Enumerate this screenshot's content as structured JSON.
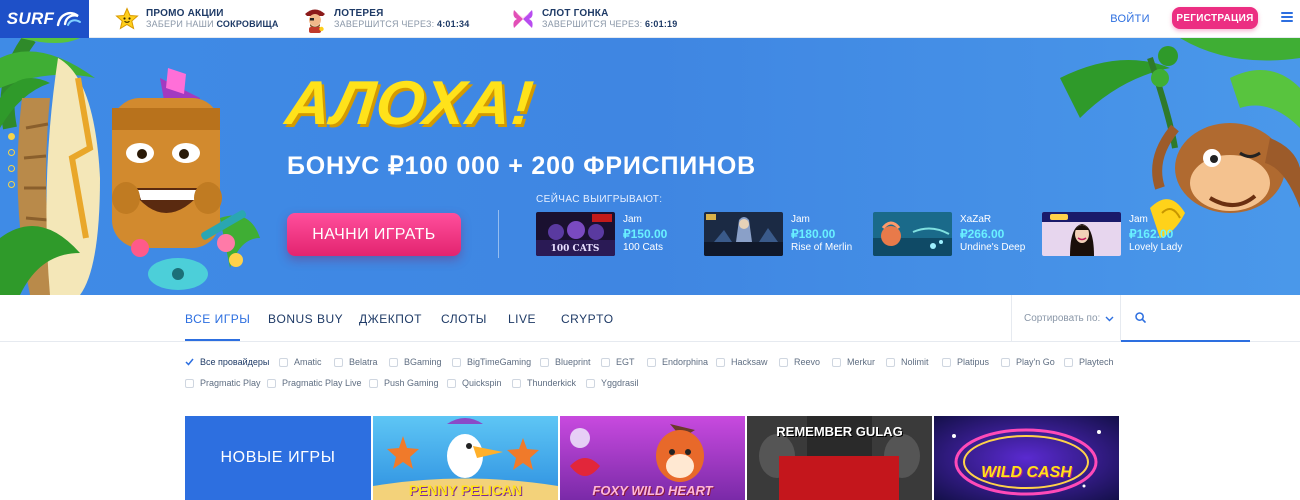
{
  "header": {
    "logo_text": "SURF",
    "promos": [
      {
        "title": "ПРОМО АКЦИИ",
        "sub_prefix": "ЗАБЕРИ НАШИ ",
        "sub_bold": "СОКРОВИЩА",
        "icon": "star-icon"
      },
      {
        "title": "ЛОТЕРЕЯ",
        "sub_prefix": "ЗАВЕРШИТСЯ ЧЕРЕЗ: ",
        "sub_bold": "4:01:34",
        "icon": "pirate-icon"
      },
      {
        "title": "СЛОТ ГОНКА",
        "sub_prefix": "ЗАВЕРШИТСЯ ЧЕРЕЗ: ",
        "sub_bold": "6:01:19",
        "icon": "butterfly-icon"
      }
    ],
    "login_label": "ВОЙТИ",
    "register_label": "РЕГИСТРАЦИЯ"
  },
  "hero": {
    "headline": "АЛОХА!",
    "bonus_text": "БОНУС ₽100 000 + 200 ФРИСПИНОВ",
    "play_button": "НАЧНИ ИГРАТЬ",
    "winning_label": "СЕЙЧАС ВЫИГРЫВАЮТ:",
    "winners": [
      {
        "player": "Jam",
        "amount": "₽150.00",
        "game": "100 Cats"
      },
      {
        "player": "Jam",
        "amount": "₽180.00",
        "game": "Rise of Merlin"
      },
      {
        "player": "XaZaR",
        "amount": "₽266.00",
        "game": "Undine's Deep"
      },
      {
        "player": "Jam",
        "amount": "₽162.00",
        "game": "Lovely Lady"
      }
    ],
    "slide_count": 4,
    "active_slide": 1
  },
  "tabs": [
    {
      "label": "ВСЕ ИГРЫ",
      "active": true
    },
    {
      "label": "BONUS BUY",
      "active": false
    },
    {
      "label": "ДЖЕКПОТ",
      "active": false
    },
    {
      "label": "СЛОТЫ",
      "active": false
    },
    {
      "label": "LIVE",
      "active": false
    },
    {
      "label": "CRYPTO",
      "active": false
    }
  ],
  "sort_label": "Сортировать по:",
  "providers": [
    {
      "name": "Все провайдеры",
      "checked": true
    },
    {
      "name": "Amatic",
      "checked": false
    },
    {
      "name": "Belatra",
      "checked": false
    },
    {
      "name": "BGaming",
      "checked": false
    },
    {
      "name": "BigTimeGaming",
      "checked": false
    },
    {
      "name": "Blueprint",
      "checked": false
    },
    {
      "name": "EGT",
      "checked": false
    },
    {
      "name": "Endorphina",
      "checked": false
    },
    {
      "name": "Hacksaw",
      "checked": false
    },
    {
      "name": "Reevo",
      "checked": false
    },
    {
      "name": "Merkur",
      "checked": false
    },
    {
      "name": "Nolimit",
      "checked": false
    },
    {
      "name": "Platipus",
      "checked": false
    },
    {
      "name": "Play'n Go",
      "checked": false
    },
    {
      "name": "Playtech",
      "checked": false
    },
    {
      "name": "Pragmatic Play",
      "checked": false
    },
    {
      "name": "Pragmatic Play Live",
      "checked": false
    },
    {
      "name": "Push Gaming",
      "checked": false
    },
    {
      "name": "Quickspin",
      "checked": false
    },
    {
      "name": "Thunderkick",
      "checked": false
    },
    {
      "name": "Yggdrasil",
      "checked": false
    }
  ],
  "games": {
    "new_games_label": "НОВЫЕ ИГРЫ",
    "tiles": [
      {
        "title": "PENNY PELICAN"
      },
      {
        "title": "FOXY WILD HEART"
      },
      {
        "title": "REMEMBER GULAG"
      },
      {
        "title": "WILD CASH"
      }
    ]
  },
  "colors": {
    "brand_blue": "#2d6fe0",
    "hero_blue": "#3f8be6",
    "accent_pink": "#ec2e82",
    "headline_yellow": "#ffe21a",
    "win_cyan": "#69f0ff"
  }
}
